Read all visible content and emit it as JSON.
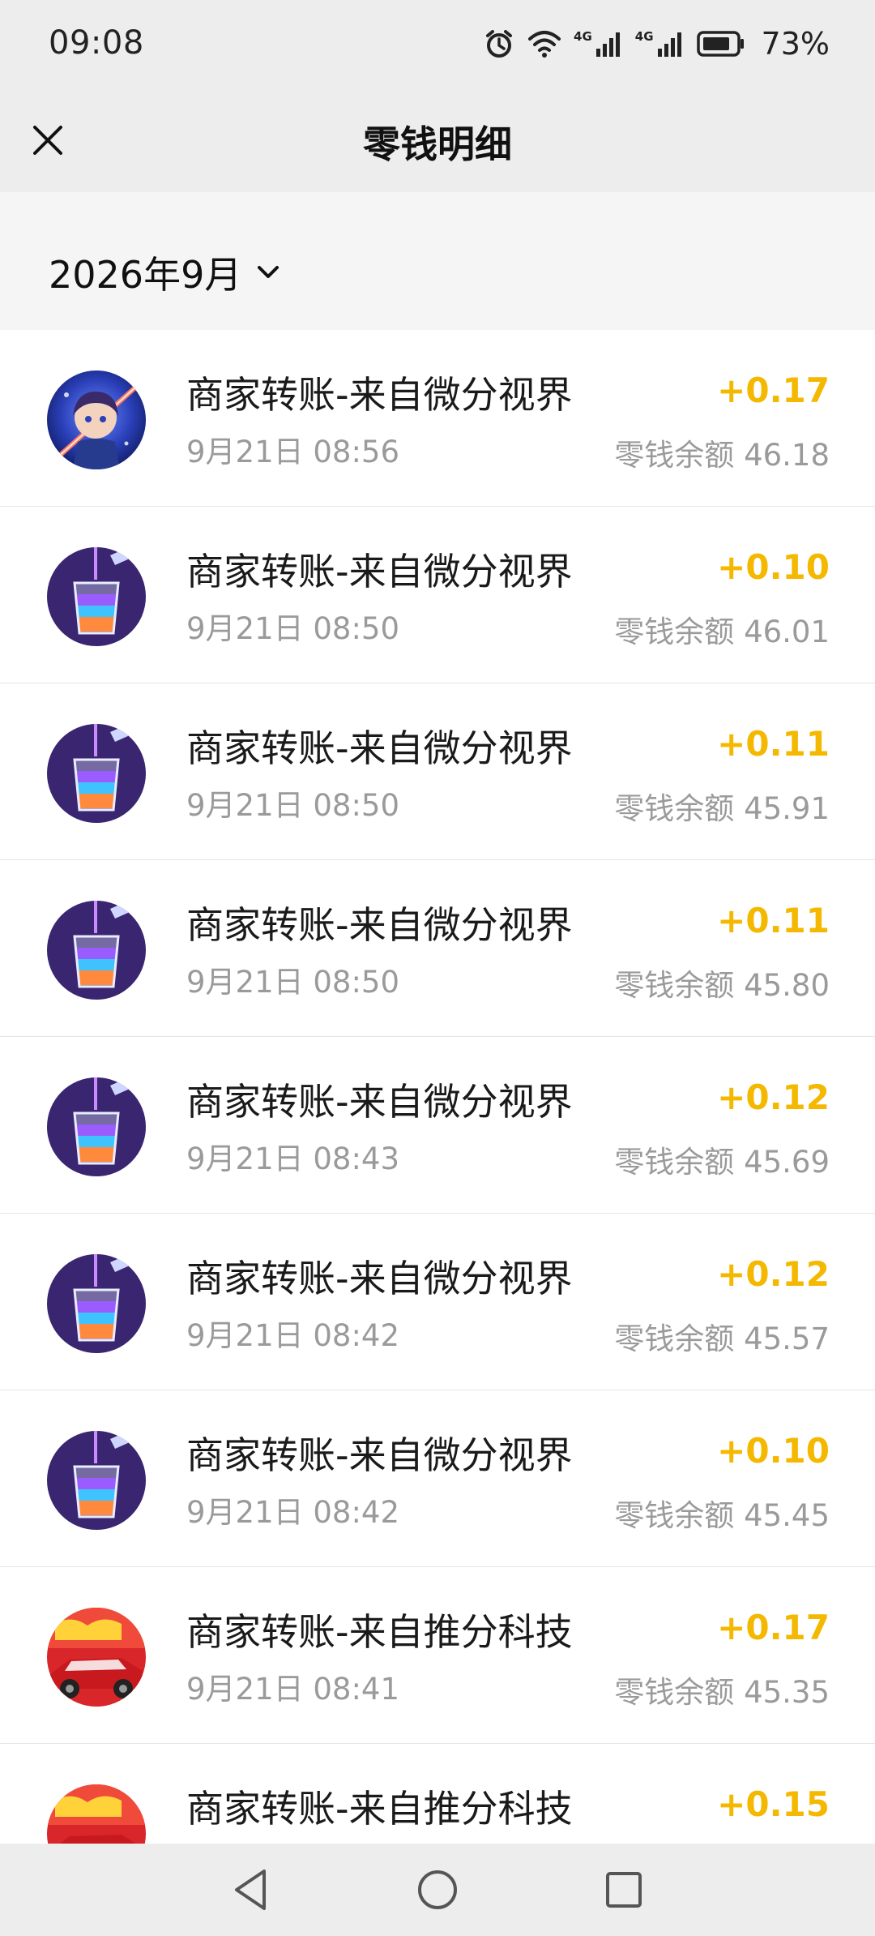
{
  "status_bar": {
    "time": "09:08",
    "battery_percent": "73%",
    "icons": [
      "alarm-icon",
      "wifi-icon",
      "signal-4g-icon",
      "signal-4g-icon",
      "battery-icon"
    ],
    "network_label": "4G"
  },
  "header": {
    "title": "零钱明细",
    "close_icon": "close-icon"
  },
  "filter": {
    "month": "2026年9月",
    "dropdown_icon": "chevron-down-icon"
  },
  "transactions": [
    {
      "title": "商家转账-来自微分视界",
      "time": "9月21日 08:56",
      "amount": "+0.17",
      "balance": "零钱余额 46.18",
      "avatar": "anime-avatar"
    },
    {
      "title": "商家转账-来自微分视界",
      "time": "9月21日 08:50",
      "amount": "+0.10",
      "balance": "零钱余额 46.01",
      "avatar": "drink-cup-avatar"
    },
    {
      "title": "商家转账-来自微分视界",
      "time": "9月21日 08:50",
      "amount": "+0.11",
      "balance": "零钱余额 45.91",
      "avatar": "drink-cup-avatar"
    },
    {
      "title": "商家转账-来自微分视界",
      "time": "9月21日 08:50",
      "amount": "+0.11",
      "balance": "零钱余额 45.80",
      "avatar": "drink-cup-avatar"
    },
    {
      "title": "商家转账-来自微分视界",
      "time": "9月21日 08:43",
      "amount": "+0.12",
      "balance": "零钱余额 45.69",
      "avatar": "drink-cup-avatar"
    },
    {
      "title": "商家转账-来自微分视界",
      "time": "9月21日 08:42",
      "amount": "+0.12",
      "balance": "零钱余额 45.57",
      "avatar": "drink-cup-avatar"
    },
    {
      "title": "商家转账-来自微分视界",
      "time": "9月21日 08:42",
      "amount": "+0.10",
      "balance": "零钱余额 45.45",
      "avatar": "drink-cup-avatar"
    },
    {
      "title": "商家转账-来自推分科技",
      "time": "9月21日 08:41",
      "amount": "+0.17",
      "balance": "零钱余额 45.35",
      "avatar": "race-car-avatar"
    },
    {
      "title": "商家转账-来自推分科技",
      "time": "",
      "amount": "+0.15",
      "balance": "",
      "avatar": "race-car-avatar"
    }
  ],
  "navigation": {
    "back_icon": "back-triangle-icon",
    "home_icon": "home-circle-icon",
    "recents_icon": "recents-square-icon"
  },
  "colors": {
    "amount": "#f5b800",
    "header_bg": "#ededed",
    "secondary_text": "#9a9a9a"
  }
}
